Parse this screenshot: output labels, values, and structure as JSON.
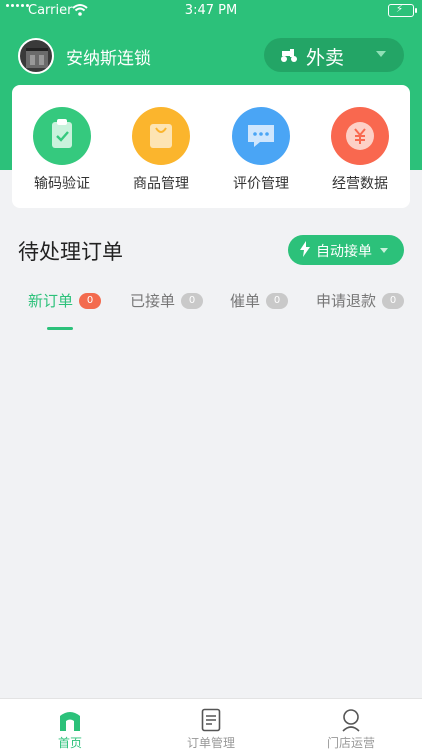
{
  "status_bar": {
    "carrier": "Carrier",
    "time": "3:47 PM"
  },
  "header": {
    "store_name": "安纳斯连锁",
    "mode": {
      "label": "外卖"
    }
  },
  "functions": [
    {
      "label": "输码验证",
      "icon": "clipboard-check-icon",
      "color": "#35c97e"
    },
    {
      "label": "商品管理",
      "icon": "shopping-bag-icon",
      "color": "#fbb52d"
    },
    {
      "label": "评价管理",
      "icon": "chat-bubble-icon",
      "color": "#4aa5f5"
    },
    {
      "label": "经营数据",
      "icon": "yen-coin-icon",
      "color": "#f9684f"
    }
  ],
  "orders": {
    "title": "待处理订单",
    "auto_accept": "自动接单",
    "tabs": [
      {
        "label": "新订单",
        "count": "0"
      },
      {
        "label": "已接单",
        "count": "0"
      },
      {
        "label": "催单",
        "count": "0"
      },
      {
        "label": "申请退款",
        "count": "0"
      }
    ]
  },
  "bottom_nav": [
    {
      "label": "首页",
      "icon": "home-icon"
    },
    {
      "label": "订单管理",
      "icon": "document-icon"
    },
    {
      "label": "门店运营",
      "icon": "store-person-icon"
    }
  ],
  "colors": {
    "brand": "#2cc17a",
    "badge_active": "#f36b4e",
    "background": "#f1f2f4"
  }
}
